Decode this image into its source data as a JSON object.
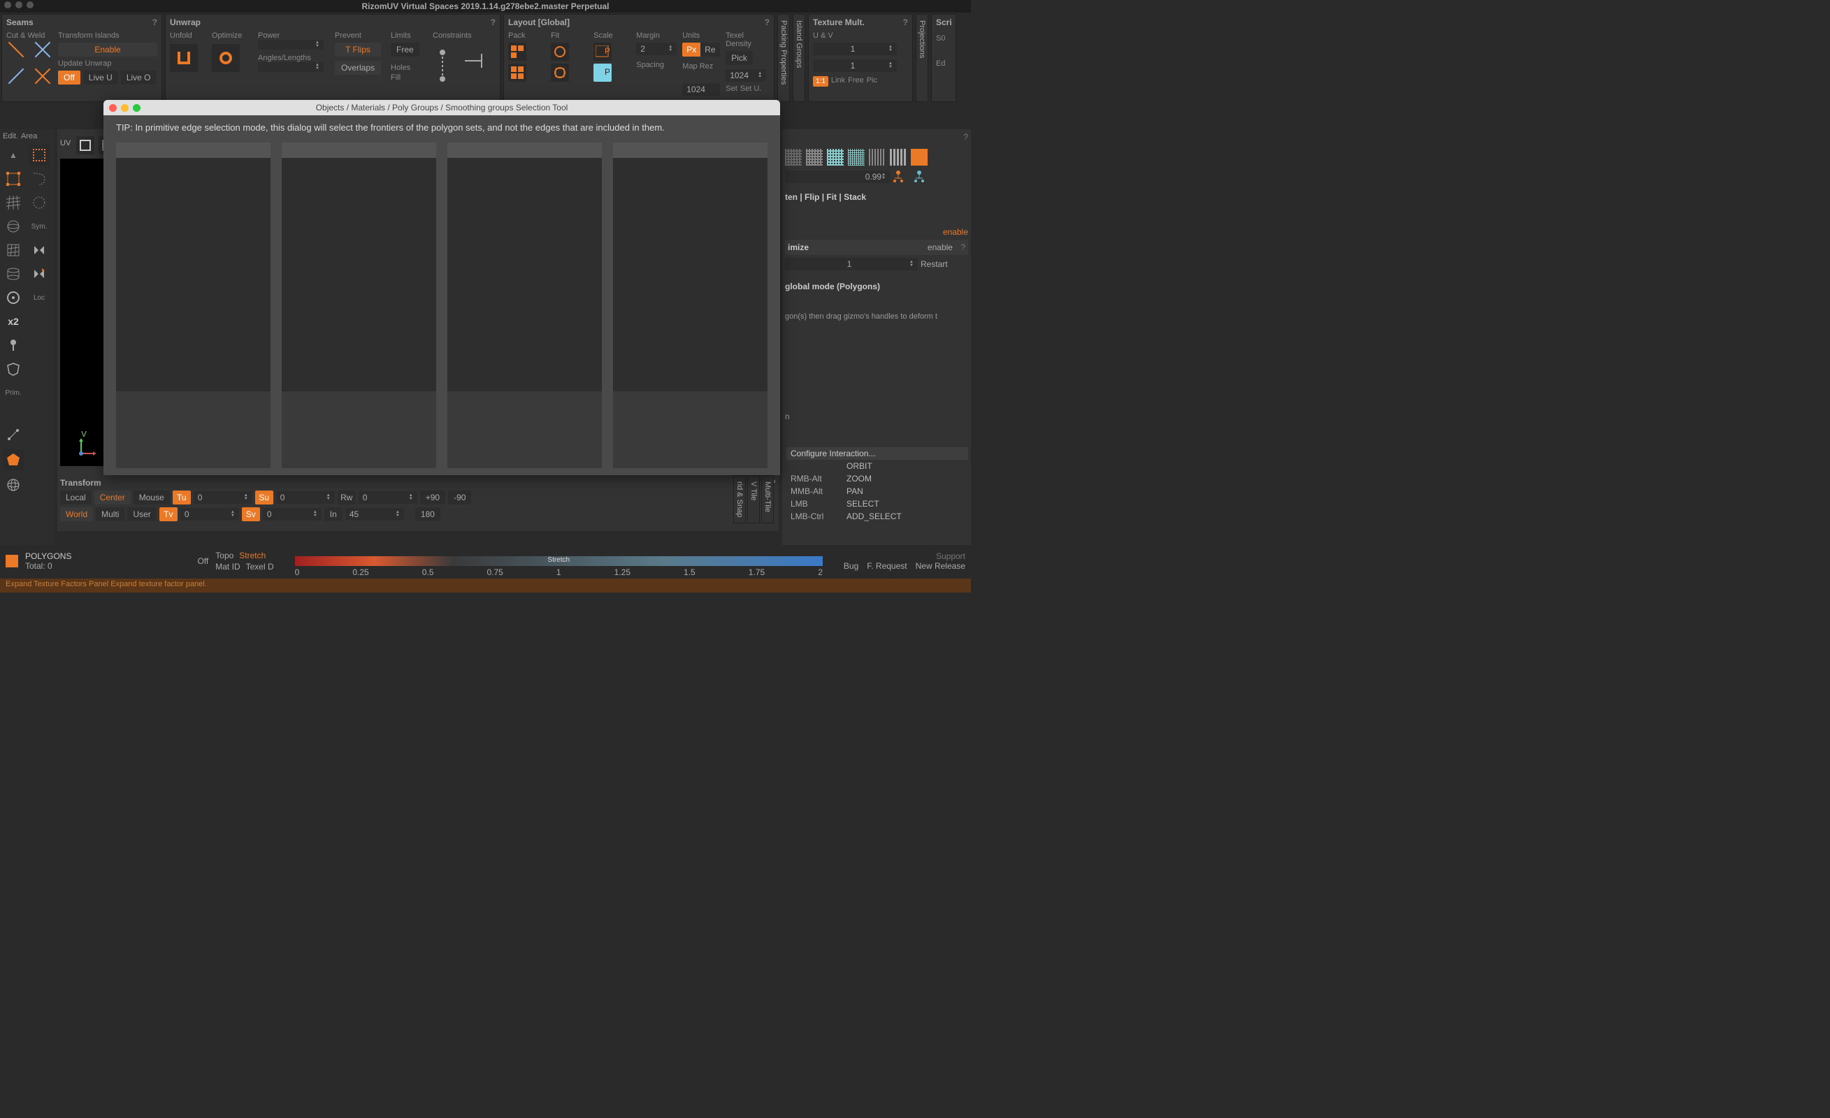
{
  "app_title": "RizomUV  Virtual Spaces 2019.1.14.g278ebe2.master Perpetual",
  "panels": {
    "seams": {
      "title": "Seams",
      "transform_islands": "Transform Islands",
      "enable": "Enable",
      "update_unwrap": "Update Unwrap",
      "off": "Off",
      "live_u": "Live U",
      "live_o": "Live O",
      "cut_weld": "Cut & Weld"
    },
    "unwrap": {
      "title": "Unwrap",
      "unfold": "Unfold",
      "optimize": "Optimize",
      "power": "Power",
      "prevent": "Prevent",
      "t_flips": "T Flips",
      "overlaps": "Overlaps",
      "limits": "Limits",
      "free": "Free",
      "holes": "Holes",
      "constraints": "Constraints",
      "angles_lengths": "Angles/Lengths",
      "fill": "Fill"
    },
    "layout": {
      "title": "Layout [Global]",
      "pack": "Pack",
      "fit": "Fit",
      "scale": "Scale",
      "margin": "Margin",
      "units": "Units",
      "texel_density": "Texel Density",
      "margin_val": "2",
      "px": "Px",
      "re": "Re",
      "pick": "Pick",
      "spacing": "Spacing",
      "map_rez": "Map Rez",
      "rez_val": "1024",
      "rez2": "1024",
      "set": "Set",
      "set_u": "Set U."
    },
    "texture": {
      "title": "Texture Mult.",
      "u_v": "U & V",
      "val1": "1",
      "val2": "1",
      "one_one": "1:1",
      "link": "Link",
      "free": "Free",
      "pic": "Pic"
    }
  },
  "vtabs": {
    "packing": "Packing Properties",
    "island": "Island Groups",
    "projections": "Projections",
    "scri": "Scri"
  },
  "scri": {
    "s0": "S0",
    "ed": "Ed"
  },
  "left": {
    "edit": "Edit.",
    "area": "Area",
    "sym": "Sym.",
    "loc": "Loc",
    "x2": "x2",
    "prim": "Prim."
  },
  "uv": {
    "title": "UV",
    "axis_v": "V"
  },
  "right": {
    "straighten": "ten | Flip | Fit | Stack",
    "num": "0.99",
    "enable": "enable",
    "imize": "imize",
    "enable2": "enable",
    "help": "?",
    "restart_val": "1",
    "restart": "Restart",
    "global_mode": " global mode (Polygons)",
    "hint": "gon(s) then drag gizmo's handles to deform t",
    "n": "n"
  },
  "interaction": {
    "configure": "Configure Interaction...",
    "rows": [
      {
        "k": "",
        "v": "ORBIT"
      },
      {
        "k": "RMB-Alt",
        "v": "ZOOM"
      },
      {
        "k": "MMB-Alt",
        "v": "PAN"
      },
      {
        "k": "LMB",
        "v": "SELECT"
      },
      {
        "k": "LMB-Ctrl",
        "v": "ADD_SELECT"
      }
    ]
  },
  "transform": {
    "title": "Transform",
    "local": "Local",
    "center": "Center",
    "mouse": "Mouse",
    "world": "World",
    "multi": "Multi",
    "user": "User",
    "tu": "Tu",
    "tu_v": "0",
    "su": "Su",
    "su_v": "0",
    "rw": "Rw",
    "rw_v": "0",
    "tv": "Tv",
    "tv_v": "0",
    "sv": "Sv",
    "sv_v": "0",
    "in": "In",
    "in_v": "45",
    "p90": "+90",
    "m90": "-90",
    "r180": "180"
  },
  "bot_vtabs": {
    "grid_snap": "rid & Snap",
    "uv_tile": "V Tile",
    "multi_tile": "Multi-Tile"
  },
  "status": {
    "mode": "POLYGONS",
    "total": "Total: 0",
    "off": "Off",
    "topo": "Topo",
    "stretch": "Stretch",
    "mat_id": "Mat ID",
    "texel_d": "Texel D",
    "grad_label": "Stretch",
    "ticks": [
      "0",
      "0.25",
      "0.5",
      "0.75",
      "1",
      "1.25",
      "1.5",
      "1.75",
      "2"
    ],
    "support": "Support",
    "bug": "Bug",
    "frequest": "F. Request",
    "new_release": "New Release"
  },
  "tooltip": "Expand Texture Factors Panel  Expand texture factor panel.",
  "modal": {
    "title": "Objects / Materials / Poly Groups / Smoothing groups Selection Tool",
    "tip": "TIP: In primitive edge selection mode, this dialog will select the frontiers of the polygon sets, and not the edges that are included in them."
  }
}
